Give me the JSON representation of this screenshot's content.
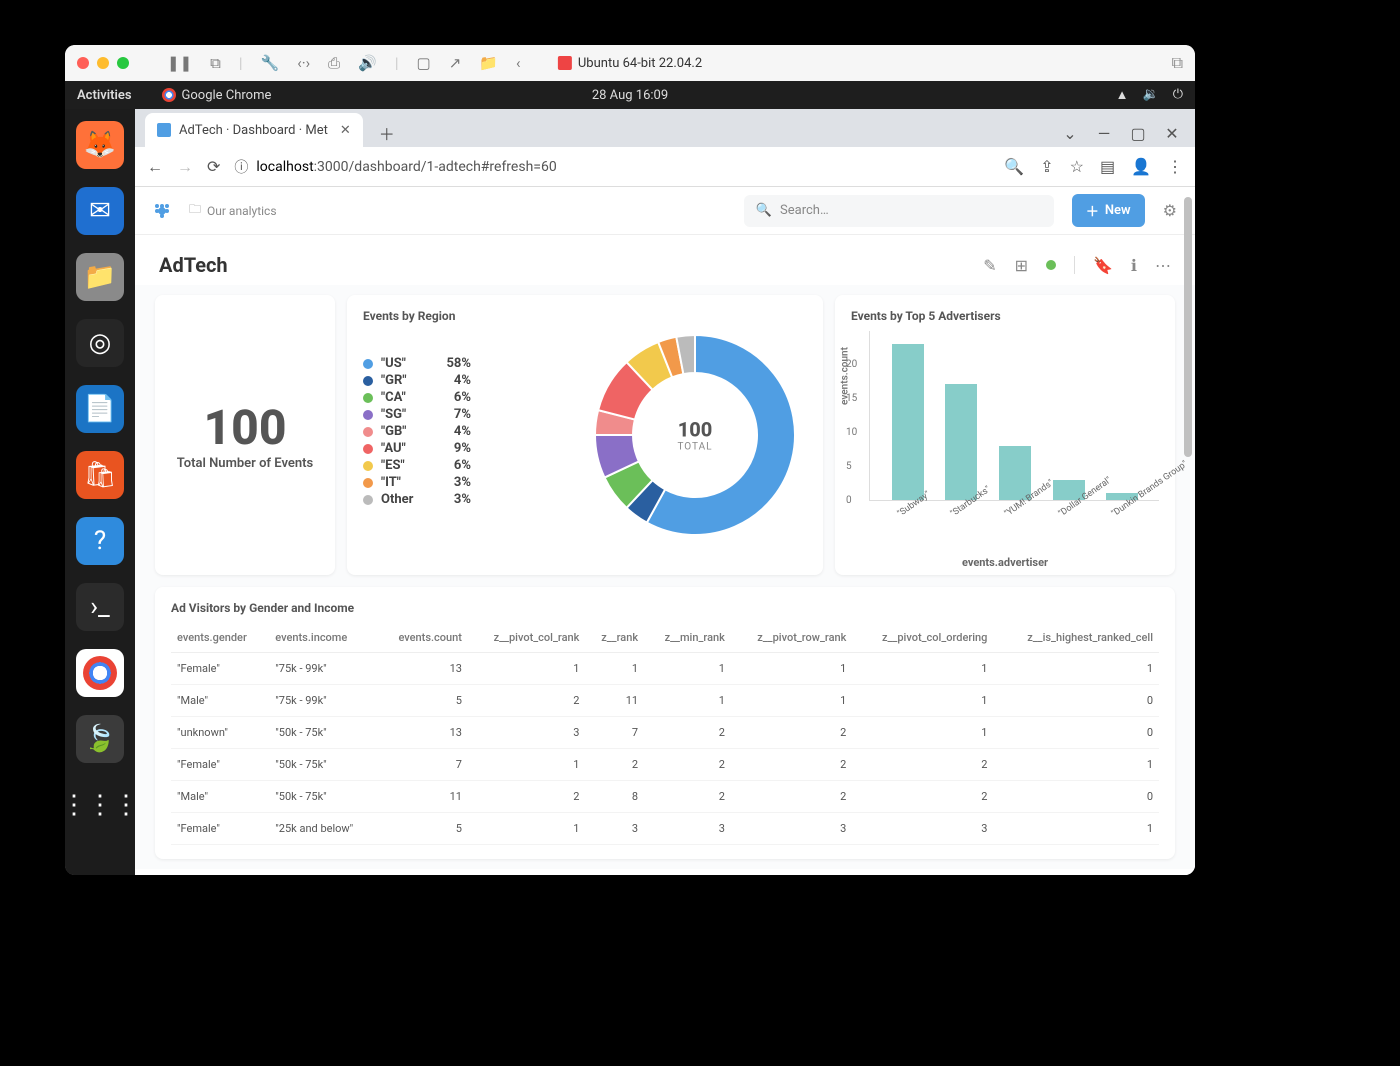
{
  "mac": {
    "title": "Ubuntu 64-bit 22.04.2",
    "toolbar_icons": [
      "pause",
      "screenshot",
      "wrench",
      "code",
      "print",
      "volume",
      "camera",
      "send",
      "folder",
      "back"
    ]
  },
  "ubuntu": {
    "activities": "Activities",
    "app": "Google Chrome",
    "clock": "28 Aug  16:09",
    "dock": [
      "firefox",
      "thunderbird",
      "files",
      "rhythmbox",
      "writer",
      "software",
      "help",
      "terminal",
      "chrome",
      "mongodb",
      "apps"
    ]
  },
  "browser": {
    "tab_title": "AdTech · Dashboard · Met",
    "url_host": "localhost",
    "url_rest": ":3000/dashboard/1-adtech#refresh=60",
    "window_buttons": [
      "minimize",
      "maximize",
      "close"
    ]
  },
  "metabase": {
    "collection": "Our analytics",
    "search_placeholder": "Search…",
    "new_label": "New",
    "dashboard_title": "AdTech"
  },
  "kpi": {
    "value": "100",
    "label": "Total Number of Events"
  },
  "chart_data": [
    {
      "type": "pie",
      "title": "Events by Region",
      "center_value": "100",
      "center_label": "TOTAL",
      "series": [
        {
          "name": "\"US\"",
          "pct": 58,
          "color": "#509ee3"
        },
        {
          "name": "\"GR\"",
          "pct": 4,
          "color": "#2a5fa0"
        },
        {
          "name": "\"CA\"",
          "pct": 6,
          "color": "#6bbf59"
        },
        {
          "name": "\"SG\"",
          "pct": 7,
          "color": "#8a6fc7"
        },
        {
          "name": "\"GB\"",
          "pct": 4,
          "color": "#f08c8c"
        },
        {
          "name": "\"AU\"",
          "pct": 9,
          "color": "#ef6464"
        },
        {
          "name": "\"ES\"",
          "pct": 6,
          "color": "#f2c94c"
        },
        {
          "name": "\"IT\"",
          "pct": 3,
          "color": "#f2994a"
        },
        {
          "name": "Other",
          "pct": 3,
          "color": "#bbb"
        }
      ]
    },
    {
      "type": "bar",
      "title": "Events by Top 5 Advertisers",
      "xlabel": "events.advertiser",
      "ylabel": "events.count",
      "ylim": [
        0,
        25
      ],
      "yticks": [
        0,
        5,
        10,
        15,
        20
      ],
      "categories": [
        "\"Subway\"",
        "\"Starbucks\"",
        "\"YUM! Brands\"",
        "\"Dollar General\"",
        "\"Dunkin Brands Group\""
      ],
      "values": [
        23,
        17,
        8,
        3,
        1
      ]
    }
  ],
  "table": {
    "title": "Ad Visitors by Gender and Income",
    "columns": [
      "events.gender",
      "events.income",
      "events.count",
      "z__pivot_col_rank",
      "z__rank",
      "z__min_rank",
      "z__pivot_row_rank",
      "z__pivot_col_ordering",
      "z__is_highest_ranked_cell"
    ],
    "rows": [
      [
        "\"Female\"",
        "\"75k - 99k\"",
        "13",
        "1",
        "1",
        "1",
        "1",
        "1",
        "1"
      ],
      [
        "\"Male\"",
        "\"75k - 99k\"",
        "5",
        "2",
        "11",
        "1",
        "1",
        "1",
        "0"
      ],
      [
        "\"unknown\"",
        "\"50k - 75k\"",
        "13",
        "3",
        "7",
        "2",
        "2",
        "1",
        "0"
      ],
      [
        "\"Female\"",
        "\"50k - 75k\"",
        "7",
        "1",
        "2",
        "2",
        "2",
        "2",
        "1"
      ],
      [
        "\"Male\"",
        "\"50k - 75k\"",
        "11",
        "2",
        "8",
        "2",
        "2",
        "2",
        "0"
      ],
      [
        "\"Female\"",
        "\"25k and below\"",
        "5",
        "1",
        "3",
        "3",
        "3",
        "3",
        "1"
      ]
    ]
  }
}
